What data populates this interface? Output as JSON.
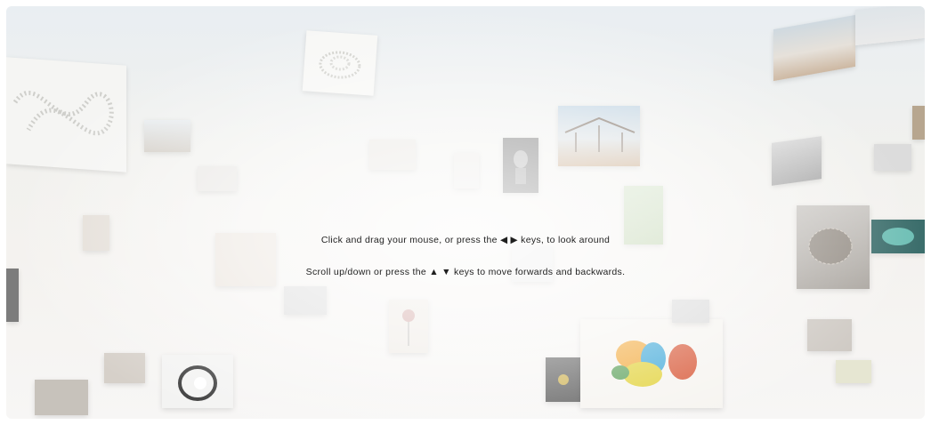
{
  "instructions": {
    "line1": "Click and drag your mouse, or press the ◀ ▶ keys, to look around",
    "line2": "Scroll up/down or press the ▲ ▼ keys to move forwards and backwards."
  },
  "artworks": [
    {
      "name": "pearl-infinity-artwork",
      "color": "#e4e4e0"
    },
    {
      "name": "pearl-spiral-artwork",
      "color": "#ecece8"
    },
    {
      "name": "canopy-structure-artwork",
      "color": "#c9b49a"
    },
    {
      "name": "desert-landscape-artwork",
      "color": "#d8cfc3"
    },
    {
      "name": "dark-sculpture-artwork",
      "color": "#6e6e6e"
    },
    {
      "name": "faceted-sphere-artwork",
      "color": "#b9b4ae"
    },
    {
      "name": "teal-blob-artwork",
      "color": "#9ec7c2"
    },
    {
      "name": "colorful-figures-artwork",
      "color": "#f0a838"
    },
    {
      "name": "concrete-pavilion-artwork",
      "color": "#8f8f8f"
    }
  ]
}
